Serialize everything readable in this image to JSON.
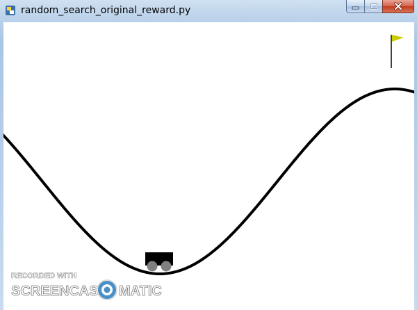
{
  "window": {
    "title": "random_search_original_reward.py",
    "controls": {
      "minimize_icon": "minimize-icon",
      "maximize_icon": "maximize-icon",
      "close_icon": "close-icon"
    }
  },
  "game": {
    "environment": "mountain-car",
    "colors": {
      "track": "#000000",
      "car_body": "#000000",
      "wheels": "#808080",
      "flag": "#cccc00",
      "background": "#ffffff"
    }
  },
  "watermark": {
    "line1": "RECORDED WITH",
    "brand_left": "SCREENCAST",
    "brand_right": "MATIC"
  }
}
